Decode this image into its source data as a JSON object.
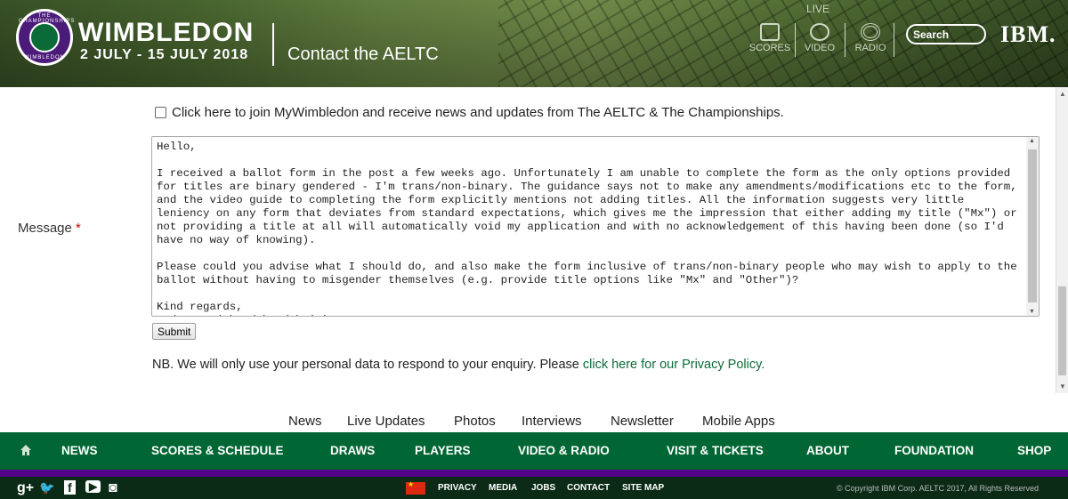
{
  "header": {
    "brand": "WIMBLEDON",
    "dates": "2 JULY - 15 JULY 2018",
    "page_title": "Contact the AELTC",
    "logo_top": "THE CHAMPIONSHIPS",
    "logo_bottom": "WIMBLEDON",
    "live_label": "LIVE",
    "nav": [
      {
        "label": "SCORES",
        "icon": "scores-icon"
      },
      {
        "label": "VIDEO",
        "icon": "video-icon"
      },
      {
        "label": "RADIO",
        "icon": "radio-icon"
      }
    ],
    "search_placeholder": "Search",
    "sponsor": "IBM."
  },
  "form": {
    "checkbox_label": "Click here to join MyWimbledon and receive news and updates from The AELTC & The Championships.",
    "checkbox_checked": false,
    "message_label": "Message",
    "required_marker": "*",
    "message_value": "Hello,\n\nI received a ballot form in the post a few weeks ago. Unfortunately I am unable to complete the form as the only options provided for titles are binary gendered - I'm trans/non-binary. The guidance says not to make any amendments/modifications etc to the form, and the video guide to completing the form explicitly mentions not adding titles. All the information suggests very little leniency on any form that deviates from standard expectations, which gives me the impression that either adding my title (\"Mx\") or not providing a title at all will automatically void my application and with no acknowledgement of this having been done (so I'd have no way of knowing).\n\nPlease could you advise what I should do, and also make the form inclusive of trans/non-binary people who may wish to apply to the ballot without having to misgender themselves (e.g. provide title options like \"Mx\" and \"Other\")?\n\nKind regards,\nAndy Law (they/them/their)",
    "submit_label": "Submit",
    "privacy_note": "NB. We will only use your personal data to respond to your enquiry. Please ",
    "privacy_link": "click here for our Privacy Policy."
  },
  "footer_links": [
    "News",
    "Live Updates",
    "Photos",
    "Interviews",
    "Newsletter",
    "Mobile Apps"
  ],
  "main_nav": [
    "NEWS",
    "SCORES & SCHEDULE",
    "DRAWS",
    "PLAYERS",
    "VIDEO & RADIO",
    "VISIT & TICKETS",
    "ABOUT",
    "FOUNDATION",
    "SHOP"
  ],
  "social": [
    {
      "label": "g+",
      "icon": "google-plus-icon"
    },
    {
      "label": "🐦",
      "icon": "twitter-icon"
    },
    {
      "label": "f",
      "icon": "facebook-icon"
    },
    {
      "label": "▶",
      "icon": "youtube-icon"
    },
    {
      "label": "◙",
      "icon": "instagram-icon"
    }
  ],
  "bottom_links": [
    "PRIVACY",
    "MEDIA",
    "JOBS",
    "CONTACT",
    "SITE MAP"
  ],
  "copyright": "© Copyright IBM Corp. AELTC 2017, All Rights Reserved",
  "colors": {
    "brand_green": "#006633",
    "brand_purple": "#54008b",
    "link_green": "#0b6b38"
  }
}
